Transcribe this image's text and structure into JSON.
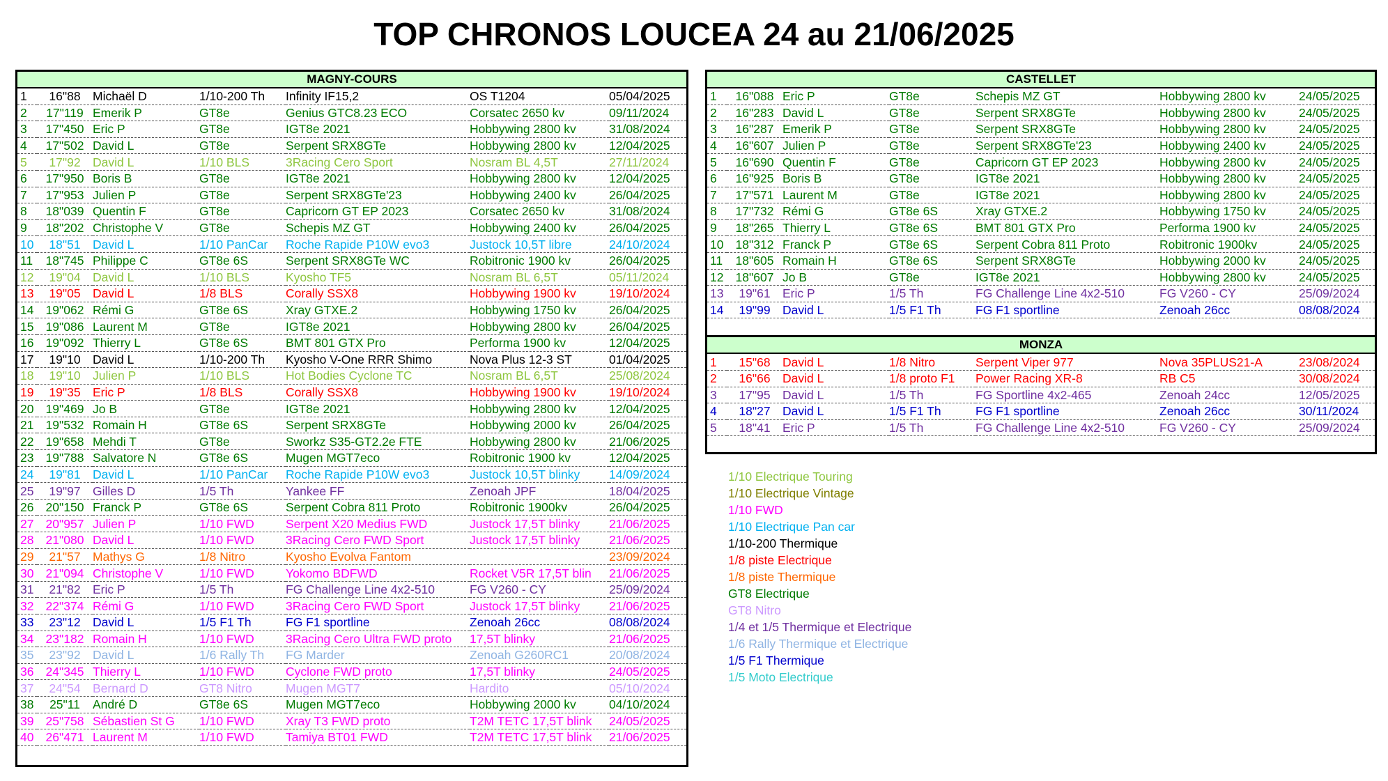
{
  "title": "TOP CHRONOS LOUCEA 24 au 21/06/2025",
  "colors": {
    "touring": "#8ec63f",
    "vintage": "#7f7f00",
    "fwd": "#ff00ff",
    "pancar": "#00b0f0",
    "thermique_200": "#000000",
    "piste_electrique": "#ff0000",
    "piste_thermique": "#ff6600",
    "gt8_electrique": "#007a00",
    "gt8_nitro": "#cc99ff",
    "thermique_electrique_14_15": "#7030a0",
    "rally": "#8fb4e3",
    "f1": "#0000cc",
    "moto": "#33cccc"
  },
  "magny": {
    "title": "MAGNY-COURS",
    "rows": [
      {
        "rank": "1",
        "time": "16\"88",
        "driver": "Michaël D",
        "category": "1/10-200 Th",
        "car": "Infinity IF15,2",
        "motor": "OS T1204",
        "date": "05/04/2025",
        "color": "#000000"
      },
      {
        "rank": "2",
        "time": "17\"119",
        "driver": "Emerik P",
        "category": "GT8e",
        "car": "Genius GTC8.23 ECO",
        "motor": "Corsatec 2650 kv",
        "date": "09/11/2024",
        "color": "#007a00"
      },
      {
        "rank": "3",
        "time": "17\"450",
        "driver": "Eric P",
        "category": "GT8e",
        "car": "IGT8e 2021",
        "motor": "Hobbywing 2800 kv",
        "date": "31/08/2024",
        "color": "#007a00"
      },
      {
        "rank": "4",
        "time": "17\"502",
        "driver": "David L",
        "category": "GT8e",
        "car": "Serpent SRX8GTe",
        "motor": "Hobbywing 2800 kv",
        "date": "12/04/2025",
        "color": "#007a00"
      },
      {
        "rank": "5",
        "time": "17\"92",
        "driver": "David L",
        "category": "1/10 BLS",
        "car": "3Racing Cero Sport",
        "motor": "Nosram BL 4,5T",
        "date": "27/11/2024",
        "color": "#8ec63f"
      },
      {
        "rank": "6",
        "time": "17\"950",
        "driver": "Boris B",
        "category": "GT8e",
        "car": "IGT8e 2021",
        "motor": "Hobbywing 2800 kv",
        "date": "12/04/2025",
        "color": "#007a00"
      },
      {
        "rank": "7",
        "time": "17\"953",
        "driver": "Julien P",
        "category": "GT8e",
        "car": "Serpent SRX8GTe'23",
        "motor": "Hobbywing 2400 kv",
        "date": "26/04/2025",
        "color": "#007a00"
      },
      {
        "rank": "8",
        "time": "18\"039",
        "driver": "Quentin F",
        "category": "GT8e",
        "car": "Capricorn GT EP 2023",
        "motor": "Corsatec 2650 kv",
        "date": "31/08/2024",
        "color": "#007a00"
      },
      {
        "rank": "9",
        "time": "18\"202",
        "driver": "Christophe V",
        "category": "GT8e",
        "car": "Schepis MZ GT",
        "motor": "Hobbywing 2400 kv",
        "date": "26/04/2025",
        "color": "#007a00"
      },
      {
        "rank": "10",
        "time": "18\"51",
        "driver": "David L",
        "category": "1/10 PanCar",
        "car": "Roche Rapide P10W evo3",
        "motor": "Justock 10,5T libre",
        "date": "24/10/2024",
        "color": "#00b0f0"
      },
      {
        "rank": "11",
        "time": "18\"745",
        "driver": "Philippe C",
        "category": "GT8e 6S",
        "car": "Serpent SRX8GTe WC",
        "motor": "Robitronic 1900 kv",
        "date": "26/04/2025",
        "color": "#007a00"
      },
      {
        "rank": "12",
        "time": "19\"04",
        "driver": "David L",
        "category": "1/10 BLS",
        "car": "Kyosho TF5",
        "motor": "Nosram BL 6,5T",
        "date": "05/11/2024",
        "color": "#8ec63f"
      },
      {
        "rank": "13",
        "time": "19\"05",
        "driver": "David L",
        "category": "1/8 BLS",
        "car": "Corally SSX8",
        "motor": "Hobbywing 1900 kv",
        "date": "19/10/2024",
        "color": "#ff0000"
      },
      {
        "rank": "14",
        "time": "19\"062",
        "driver": "Rémi G",
        "category": "GT8e 6S",
        "car": "Xray GTXE.2",
        "motor": "Hobbywing 1750 kv",
        "date": "26/04/2025",
        "color": "#007a00"
      },
      {
        "rank": "15",
        "time": "19\"086",
        "driver": "Laurent M",
        "category": "GT8e",
        "car": "IGT8e 2021",
        "motor": "Hobbywing 2800 kv",
        "date": "26/04/2025",
        "color": "#007a00"
      },
      {
        "rank": "16",
        "time": "19\"092",
        "driver": "Thierry L",
        "category": "GT8e 6S",
        "car": "BMT 801 GTX Pro",
        "motor": "Performa 1900 kv",
        "date": "12/04/2025",
        "color": "#007a00"
      },
      {
        "rank": "17",
        "time": "19\"10",
        "driver": "David L",
        "category": "1/10-200 Th",
        "car": "Kyosho V-One RRR Shimo",
        "motor": "Nova Plus 12-3 ST",
        "date": "01/04/2025",
        "color": "#000000"
      },
      {
        "rank": "18",
        "time": "19\"10",
        "driver": "Julien P",
        "category": "1/10 BLS",
        "car": "Hot Bodies Cyclone TC",
        "motor": "Nosram BL 6,5T",
        "date": "25/08/2024",
        "color": "#8ec63f"
      },
      {
        "rank": "19",
        "time": "19\"35",
        "driver": "Eric P",
        "category": "1/8 BLS",
        "car": "Corally SSX8",
        "motor": "Hobbywing 1900 kv",
        "date": "19/10/2024",
        "color": "#ff0000"
      },
      {
        "rank": "20",
        "time": "19\"469",
        "driver": "Jo B",
        "category": "GT8e",
        "car": "IGT8e 2021",
        "motor": "Hobbywing 2800 kv",
        "date": "12/04/2025",
        "color": "#007a00"
      },
      {
        "rank": "21",
        "time": "19\"532",
        "driver": "Romain H",
        "category": "GT8e 6S",
        "car": "Serpent SRX8GTe",
        "motor": "Hobbywing 2000 kv",
        "date": "26/04/2025",
        "color": "#007a00"
      },
      {
        "rank": "22",
        "time": "19\"658",
        "driver": "Mehdi T",
        "category": "GT8e",
        "car": "Sworkz S35-GT2.2e FTE",
        "motor": "Hobbywing 2800 kv",
        "date": "21/06/2025",
        "color": "#007a00"
      },
      {
        "rank": "23",
        "time": "19\"788",
        "driver": "Salvatore N",
        "category": "GT8e 6S",
        "car": "Mugen MGT7eco",
        "motor": "Robitronic 1900 kv",
        "date": "12/04/2025",
        "color": "#007a00"
      },
      {
        "rank": "24",
        "time": "19\"81",
        "driver": "David L",
        "category": "1/10 PanCar",
        "car": "Roche Rapide P10W evo3",
        "motor": "Justock 10,5T blinky",
        "date": "14/09/2024",
        "color": "#00b0f0"
      },
      {
        "rank": "25",
        "time": "19\"97",
        "driver": "Gilles D",
        "category": "1/5 Th",
        "car": "Yankee FF",
        "motor": "Zenoah JPF",
        "date": "18/04/2025",
        "color": "#7030a0"
      },
      {
        "rank": "26",
        "time": "20\"150",
        "driver": "Franck P",
        "category": "GT8e 6S",
        "car": "Serpent Cobra 811 Proto",
        "motor": "Robitronic 1900kv",
        "date": "26/04/2025",
        "color": "#007a00"
      },
      {
        "rank": "27",
        "time": "20\"957",
        "driver": "Julien P",
        "category": "1/10 FWD",
        "car": "Serpent X20 Medius FWD",
        "motor": "Justock 17,5T blinky",
        "date": "21/06/2025",
        "color": "#ff00ff"
      },
      {
        "rank": "28",
        "time": "21\"080",
        "driver": "David L",
        "category": "1/10 FWD",
        "car": "3Racing Cero FWD Sport",
        "motor": "Justock 17,5T blinky",
        "date": "21/06/2025",
        "color": "#ff00ff"
      },
      {
        "rank": "29",
        "time": "21\"57",
        "driver": "Mathys G",
        "category": "1/8 Nitro",
        "car": "Kyosho Evolva Fantom",
        "motor": "",
        "date": "23/09/2024",
        "color": "#ff6600"
      },
      {
        "rank": "30",
        "time": "21\"094",
        "driver": "Christophe V",
        "category": "1/10 FWD",
        "car": "Yokomo BDFWD",
        "motor": "Rocket V5R 17,5T blin",
        "date": "21/06/2025",
        "color": "#ff00ff"
      },
      {
        "rank": "31",
        "time": "21\"82",
        "driver": "Eric P",
        "category": "1/5 Th",
        "car": "FG Challenge Line 4x2-510",
        "motor": "FG V260 - CY",
        "date": "25/09/2024",
        "color": "#7030a0"
      },
      {
        "rank": "32",
        "time": "22\"374",
        "driver": "Rémi G",
        "category": "1/10 FWD",
        "car": "3Racing Cero FWD Sport",
        "motor": "Justock 17,5T blinky",
        "date": "21/06/2025",
        "color": "#ff00ff"
      },
      {
        "rank": "33",
        "time": "23\"12",
        "driver": "David L",
        "category": "1/5 F1 Th",
        "car": "FG F1 sportline",
        "motor": "Zenoah 26cc",
        "date": "08/08/2024",
        "color": "#0000cc"
      },
      {
        "rank": "34",
        "time": "23\"182",
        "driver": "Romain H",
        "category": "1/10 FWD",
        "car": "3Racing Cero Ultra FWD proto",
        "motor": "17,5T blinky",
        "date": "21/06/2025",
        "color": "#ff00ff"
      },
      {
        "rank": "35",
        "time": "23\"92",
        "driver": "David L",
        "category": "1/6 Rally Th",
        "car": "FG Marder",
        "motor": "Zenoah G260RC1",
        "date": "20/08/2024",
        "color": "#8fb4e3"
      },
      {
        "rank": "36",
        "time": "24\"345",
        "driver": "Thierry L",
        "category": "1/10 FWD",
        "car": "Cyclone FWD proto",
        "motor": "17,5T blinky",
        "date": "24/05/2025",
        "color": "#ff00ff"
      },
      {
        "rank": "37",
        "time": "24\"54",
        "driver": "Bernard D",
        "category": "GT8 Nitro",
        "car": "Mugen MGT7",
        "motor": "Hardito",
        "date": "05/10/2024",
        "color": "#cc99ff"
      },
      {
        "rank": "38",
        "time": "25\"11",
        "driver": "André D",
        "category": "GT8e 6S",
        "car": "Mugen MGT7eco",
        "motor": "Hobbywing 2000 kv",
        "date": "04/10/2024",
        "color": "#007a00"
      },
      {
        "rank": "39",
        "time": "25\"758",
        "driver": "Sébastien St G",
        "category": "1/10 FWD",
        "car": "Xray T3 FWD proto",
        "motor": "T2M TETC 17,5T blink",
        "date": "24/05/2025",
        "color": "#ff00ff"
      },
      {
        "rank": "40",
        "time": "26\"471",
        "driver": "Laurent M",
        "category": "1/10 FWD",
        "car": "Tamiya BT01 FWD",
        "motor": "T2M TETC 17,5T blink",
        "date": "21/06/2025",
        "color": "#ff00ff"
      }
    ]
  },
  "castellet": {
    "title": "CASTELLET",
    "rows": [
      {
        "rank": "1",
        "time": "16\"088",
        "driver": "Eric P",
        "category": "GT8e",
        "car": "Schepis MZ GT",
        "motor": "Hobbywing 2800 kv",
        "date": "24/05/2025",
        "color": "#007a00"
      },
      {
        "rank": "2",
        "time": "16\"283",
        "driver": "David L",
        "category": "GT8e",
        "car": "Serpent SRX8GTe",
        "motor": "Hobbywing 2800 kv",
        "date": "24/05/2025",
        "color": "#007a00"
      },
      {
        "rank": "3",
        "time": "16\"287",
        "driver": "Emerik P",
        "category": "GT8e",
        "car": "Serpent SRX8GTe",
        "motor": "Hobbywing 2800 kv",
        "date": "24/05/2025",
        "color": "#007a00"
      },
      {
        "rank": "4",
        "time": "16\"607",
        "driver": "Julien P",
        "category": "GT8e",
        "car": "Serpent SRX8GTe'23",
        "motor": "Hobbywing 2400 kv",
        "date": "24/05/2025",
        "color": "#007a00"
      },
      {
        "rank": "5",
        "time": "16\"690",
        "driver": "Quentin F",
        "category": "GT8e",
        "car": "Capricorn GT EP 2023",
        "motor": "Hobbywing 2800 kv",
        "date": "24/05/2025",
        "color": "#007a00"
      },
      {
        "rank": "6",
        "time": "16\"925",
        "driver": "Boris B",
        "category": "GT8e",
        "car": "IGT8e 2021",
        "motor": "Hobbywing 2800 kv",
        "date": "24/05/2025",
        "color": "#007a00"
      },
      {
        "rank": "7",
        "time": "17\"571",
        "driver": "Laurent M",
        "category": "GT8e",
        "car": "IGT8e 2021",
        "motor": "Hobbywing 2800 kv",
        "date": "24/05/2025",
        "color": "#007a00"
      },
      {
        "rank": "8",
        "time": "17\"732",
        "driver": "Rémi G",
        "category": "GT8e 6S",
        "car": "Xray GTXE.2",
        "motor": "Hobbywing 1750 kv",
        "date": "24/05/2025",
        "color": "#007a00"
      },
      {
        "rank": "9",
        "time": "18\"265",
        "driver": "Thierry L",
        "category": "GT8e 6S",
        "car": "BMT 801 GTX Pro",
        "motor": "Performa 1900 kv",
        "date": "24/05/2025",
        "color": "#007a00"
      },
      {
        "rank": "10",
        "time": "18\"312",
        "driver": "Franck P",
        "category": "GT8e 6S",
        "car": "Serpent Cobra 811 Proto",
        "motor": "Robitronic 1900kv",
        "date": "24/05/2025",
        "color": "#007a00"
      },
      {
        "rank": "11",
        "time": "18\"605",
        "driver": "Romain H",
        "category": "GT8e 6S",
        "car": "Serpent SRX8GTe",
        "motor": "Hobbywing 2000 kv",
        "date": "24/05/2025",
        "color": "#007a00"
      },
      {
        "rank": "12",
        "time": "18\"607",
        "driver": "Jo B",
        "category": "GT8e",
        "car": "IGT8e 2021",
        "motor": "Hobbywing 2800 kv",
        "date": "24/05/2025",
        "color": "#007a00"
      },
      {
        "rank": "13",
        "time": "19\"61",
        "driver": "Eric P",
        "category": "1/5 Th",
        "car": "FG Challenge Line 4x2-510",
        "motor": "FG V260 - CY",
        "date": "25/09/2024",
        "color": "#7030a0"
      },
      {
        "rank": "14",
        "time": "19\"99",
        "driver": "David L",
        "category": "1/5 F1 Th",
        "car": "FG F1 sportline",
        "motor": "Zenoah 26cc",
        "date": "08/08/2024",
        "color": "#0000cc"
      }
    ]
  },
  "monza": {
    "title": "MONZA",
    "rows": [
      {
        "rank": "1",
        "time": "15\"68",
        "driver": "David L",
        "category": "1/8 Nitro",
        "car": "Serpent Viper 977",
        "motor": "Nova 35PLUS21-A",
        "date": "23/08/2024",
        "color": "#ff0000"
      },
      {
        "rank": "2",
        "time": "16\"66",
        "driver": "David L",
        "category": "1/8 proto F1",
        "car": "Power Racing XR-8",
        "motor": "RB C5",
        "date": "30/08/2024",
        "color": "#ff0000"
      },
      {
        "rank": "3",
        "time": "17\"95",
        "driver": "David L",
        "category": "1/5 Th",
        "car": "FG Sportline 4x2-465",
        "motor": "Zenoah 24cc",
        "date": "12/05/2025",
        "color": "#7030a0"
      },
      {
        "rank": "4",
        "time": "18\"27",
        "driver": "David L",
        "category": "1/5 F1 Th",
        "car": "FG F1 sportline",
        "motor": "Zenoah 26cc",
        "date": "30/11/2024",
        "color": "#0000cc"
      },
      {
        "rank": "5",
        "time": "18\"41",
        "driver": "Eric P",
        "category": "1/5 Th",
        "car": "FG Challenge Line 4x2-510",
        "motor": "FG V260 - CY",
        "date": "25/09/2024",
        "color": "#7030a0"
      }
    ]
  },
  "legend": [
    {
      "label": "1/10 Electrique Touring",
      "color": "#8ec63f"
    },
    {
      "label": "1/10 Electrique Vintage",
      "color": "#7f7f00"
    },
    {
      "label": "1/10 FWD",
      "color": "#ff00ff"
    },
    {
      "label": "1/10 Electrique Pan car",
      "color": "#00b0f0"
    },
    {
      "label": "1/10-200 Thermique",
      "color": "#000000"
    },
    {
      "label": "1/8 piste Electrique",
      "color": "#ff0000"
    },
    {
      "label": "1/8 piste Thermique",
      "color": "#ff6600"
    },
    {
      "label": "GT8 Electrique",
      "color": "#007a00"
    },
    {
      "label": "GT8 Nitro",
      "color": "#cc99ff"
    },
    {
      "label": "1/4 et 1/5 Thermique et Electrique",
      "color": "#7030a0"
    },
    {
      "label": "1/6 Rally Thermique et Electrique",
      "color": "#8fb4e3"
    },
    {
      "label": "1/5 F1 Thermique",
      "color": "#0000cc"
    },
    {
      "label": "1/5 Moto Electrique",
      "color": "#33cccc"
    }
  ]
}
